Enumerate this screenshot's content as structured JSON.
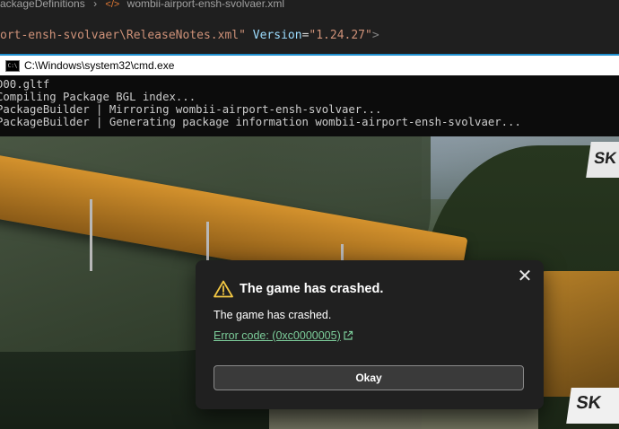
{
  "editor": {
    "breadcrumb_left": "ackageDefinitions",
    "breadcrumb_file": "wombii-airport-ensh-svolvaer.xml",
    "code_path": "ort-ensh-svolvaer\\ReleaseNotes.xml\"",
    "code_attr": "Version",
    "code_eq": "=",
    "code_value": "\"1.24.27\"",
    "code_close": ">"
  },
  "cmd": {
    "title": "C:\\Windows\\system32\\cmd.exe",
    "icon_text": "C:\\",
    "lines": [
      "D00.gltf",
      "Compiling Package BGL index...",
      "PackageBuilder | Mirroring wombii-airport-ensh-svolvaer...",
      "PackageBuilder | Generating package information wombii-airport-ensh-svolvaer..."
    ]
  },
  "scene": {
    "badge_top": "SK",
    "badge_bottom": "SK"
  },
  "dialog": {
    "title": "The game has crashed.",
    "message": "The game has crashed.",
    "link_text": "Error code: (0xc0000005)",
    "button_label": "Okay",
    "close_glyph": "✕",
    "warning_color": "#f2c744",
    "link_color": "#7ccd9a"
  },
  "icons": {
    "warning": "warning-icon",
    "external_link": "external-link-icon",
    "close": "close-icon",
    "cmd": "cmd-icon"
  }
}
